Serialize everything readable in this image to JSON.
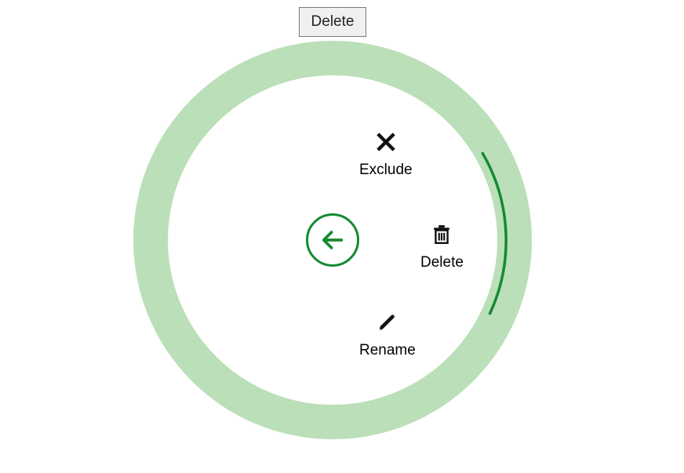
{
  "tooltip": {
    "label": "Delete"
  },
  "radialMenu": {
    "center": {
      "action": "back"
    },
    "items": [
      {
        "id": "exclude",
        "label": "Exclude",
        "icon": "close-icon"
      },
      {
        "id": "delete",
        "label": "Delete",
        "icon": "trash-icon",
        "highlighted": true
      },
      {
        "id": "rename",
        "label": "Rename",
        "icon": "pencil-icon"
      }
    ]
  },
  "colors": {
    "ring": "#bbdfb8",
    "accent": "#148a33",
    "iconFill": "#111111",
    "tooltipBg": "#f0f0f0",
    "tooltipBorder": "#7a7a7a"
  }
}
